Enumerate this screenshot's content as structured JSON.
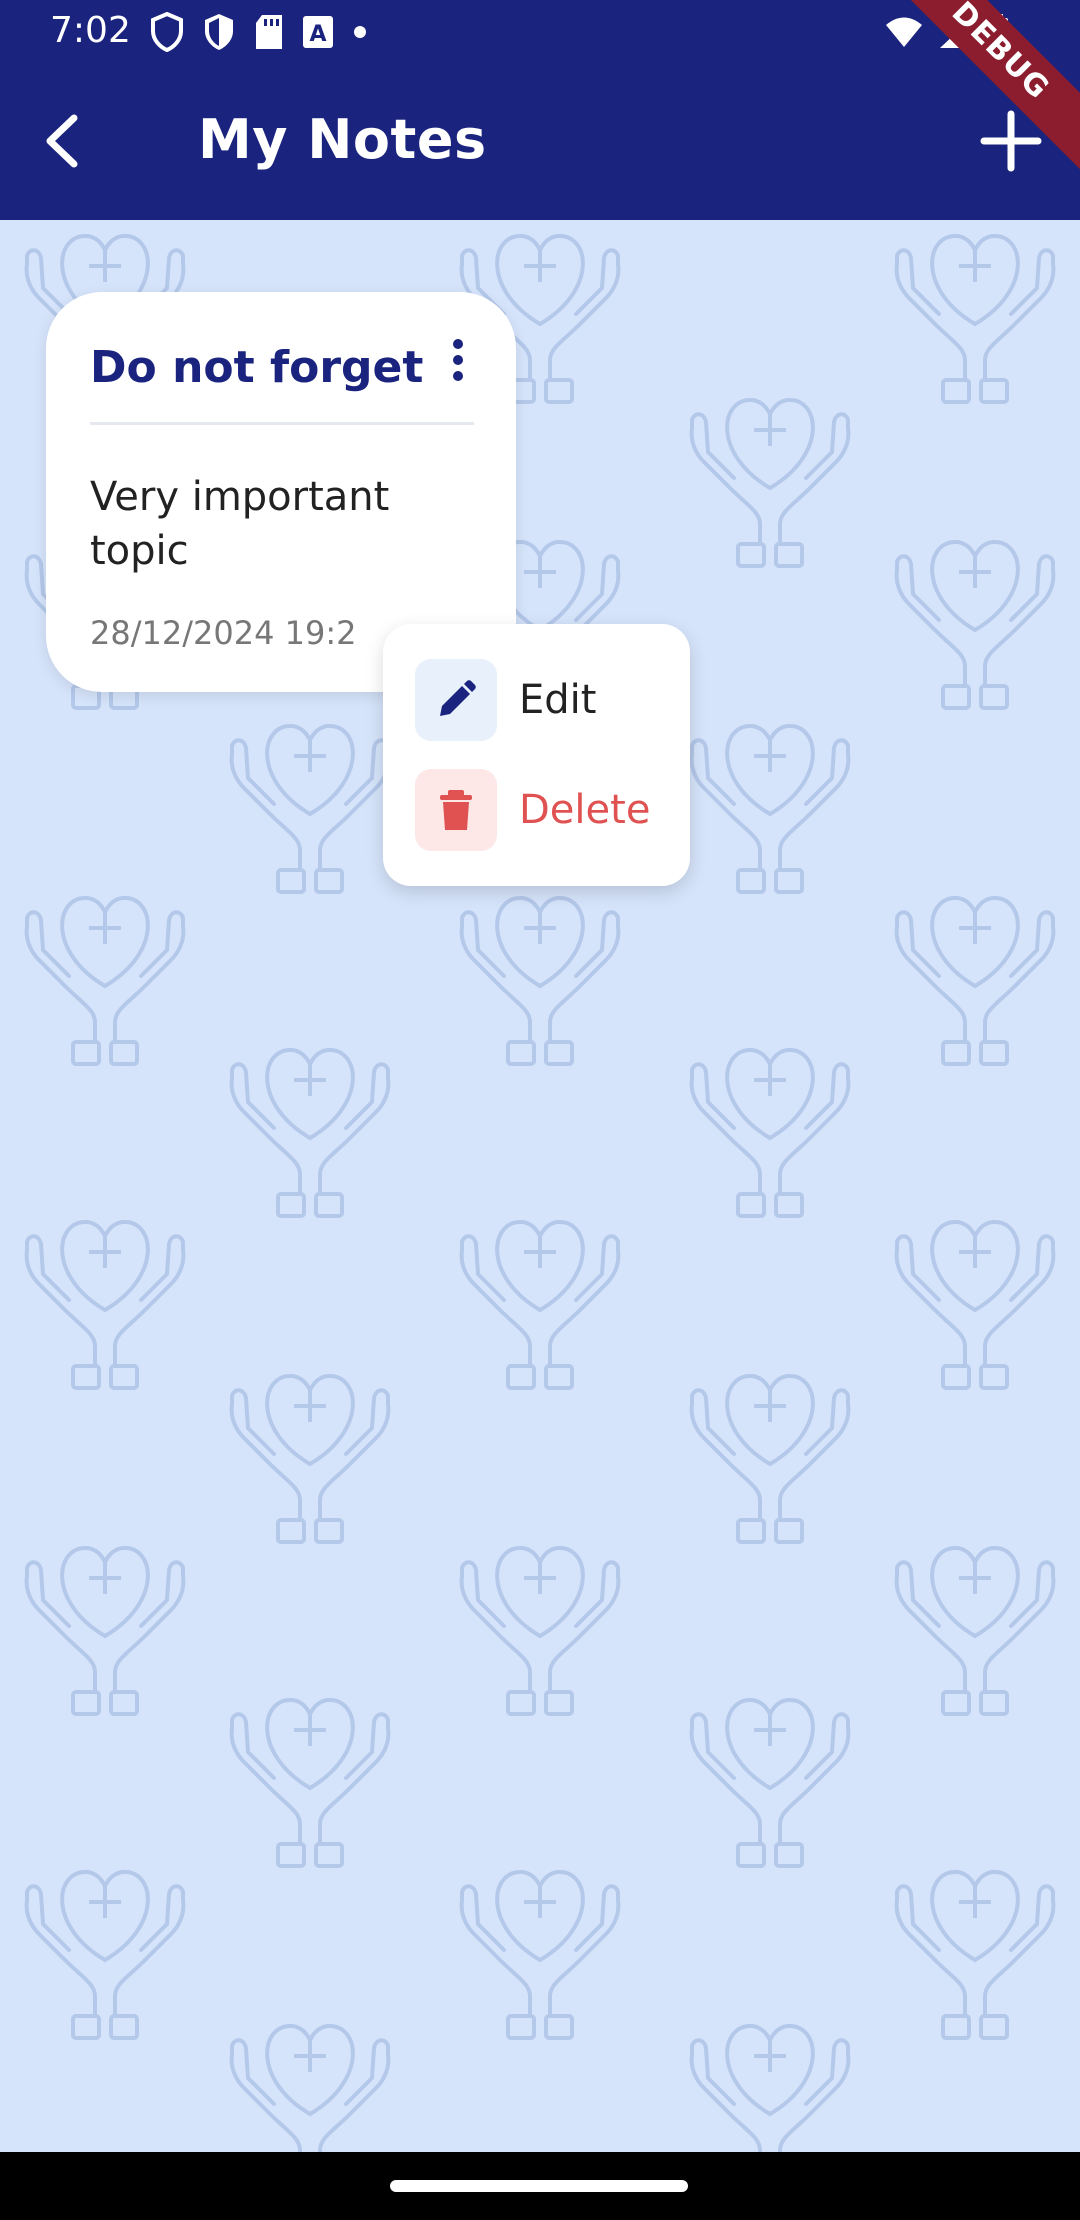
{
  "status_bar": {
    "time": "7:02",
    "icons": [
      "shield-icon",
      "shield-filled-icon",
      "sd-card-icon",
      "text-a-icon",
      "dot-icon",
      "wifi-icon",
      "signal-icon",
      "battery-icon"
    ]
  },
  "debug_banner": "DEBUG",
  "app_bar": {
    "title": "My Notes",
    "back_icon": "back-arrow-icon",
    "add_icon": "plus-icon"
  },
  "note": {
    "title": "Do not forget",
    "body": "Very important topic",
    "date": "28/12/2024 19:2"
  },
  "popup_menu": {
    "items": [
      {
        "label": "Edit",
        "icon": "pencil-icon"
      },
      {
        "label": "Delete",
        "icon": "trash-icon"
      }
    ]
  },
  "colors": {
    "primary": "#1a237e",
    "background": "#d6e4fb",
    "delete": "#e05252"
  }
}
